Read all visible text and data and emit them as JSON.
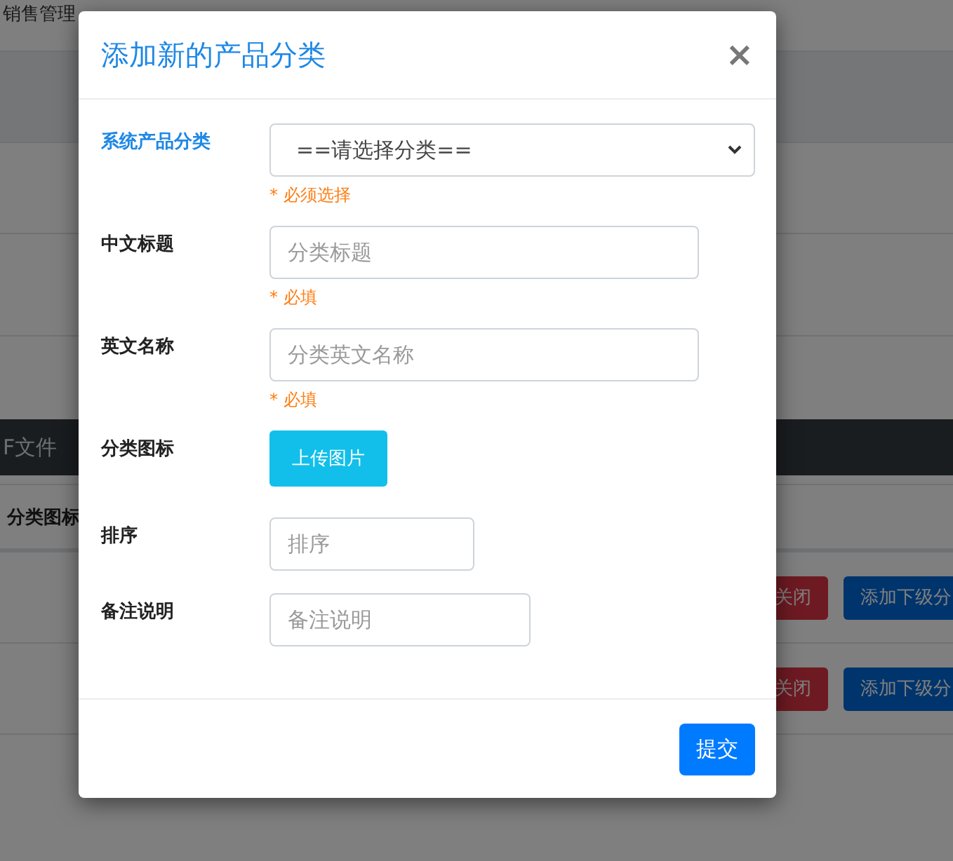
{
  "background": {
    "nav": [
      "销售管理"
    ],
    "toolbar_label": "F文件",
    "table": {
      "columns": [
        "分类图标"
      ],
      "rows": [
        {
          "actions": [
            {
              "kind": "danger",
              "label": "关闭"
            },
            {
              "kind": "primary",
              "label": "添加下级分"
            }
          ]
        },
        {
          "actions": [
            {
              "kind": "danger",
              "label": "关闭"
            },
            {
              "kind": "primary",
              "label": "添加下级分"
            }
          ]
        }
      ]
    }
  },
  "modal": {
    "title": "添加新的产品分类",
    "close": "×",
    "fields": [
      {
        "kind": "select",
        "label": "系统产品分类",
        "focused": true,
        "value": "==请选择分类==",
        "hint": "* 必须选择"
      },
      {
        "kind": "input",
        "label": "中文标题",
        "focused": false,
        "placeholder": "分类标题",
        "hint": "* 必填"
      },
      {
        "kind": "input",
        "label": "英文名称",
        "focused": false,
        "placeholder": "分类英文名称",
        "hint": "* 必填"
      },
      {
        "kind": "upload",
        "label": "分类图标",
        "focused": false,
        "button": "上传图片"
      },
      {
        "kind": "input",
        "label": "排序",
        "focused": false,
        "placeholder": "排序"
      },
      {
        "kind": "input",
        "label": "备注说明",
        "focused": false,
        "placeholder": "备注说明"
      }
    ],
    "submit": "提交"
  }
}
